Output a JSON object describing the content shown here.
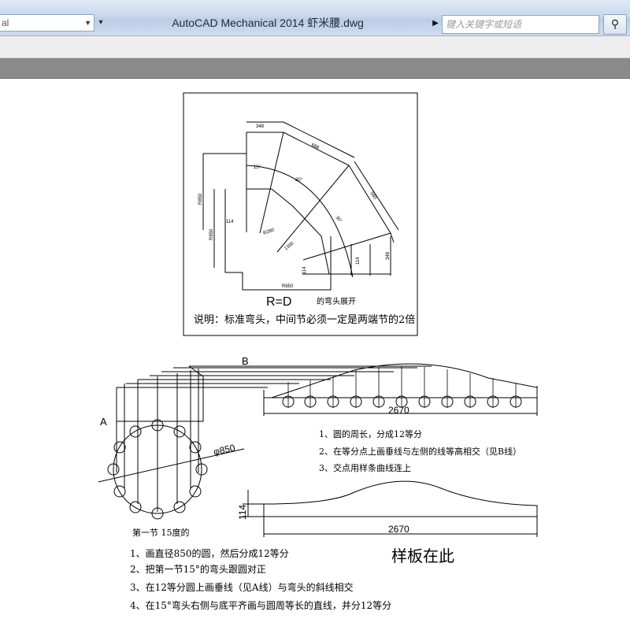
{
  "titlebar": {
    "workspace": "al",
    "app_title": "AutoCAD Mechanical 2014    虾米腰.dwg",
    "search_placeholder": "键入关键字或短语"
  },
  "drawing": {
    "top_figure": {
      "dims": {
        "d348": "348",
        "d688": "688",
        "d580a": "580",
        "d15deg": "15°",
        "d30deg": "30°",
        "d30deg_b": "30°",
        "r850a": "R850",
        "r850b": "R850",
        "d114a": "114",
        "d280": "R280",
        "d1300": "1300",
        "d114b": "114",
        "d114c": "114",
        "d348b": "348",
        "r850c": "R850"
      },
      "caption_formula": "R=D",
      "caption_suffix": "的弯头展开",
      "caption_note": "说明：标准弯头，中间节必须一定是两端节的2倍"
    },
    "bottom_figure": {
      "label_b": "B",
      "label_a": "A",
      "dia": "φ850",
      "len1": "2670",
      "len2": "2670",
      "height": "114",
      "first_section": "第一节  15度的",
      "steps_right": [
        "1、圆的周长，分成12等分",
        "2、在等分点上画垂线与左侧的线等高相交（见B线）",
        "3、交点用样条曲线连上"
      ],
      "steps_bottom": [
        "1、画直径850的圆，然后分成12等分",
        "2、把第一节15°的弯头跟圆对正",
        "3、在12等分圆上画垂线（见A线）与弯头的斜线相交",
        "4、在15°弯头右侧与底平齐画与圆周等长的直线，并分12等分"
      ],
      "template_here": "样板在此"
    }
  }
}
